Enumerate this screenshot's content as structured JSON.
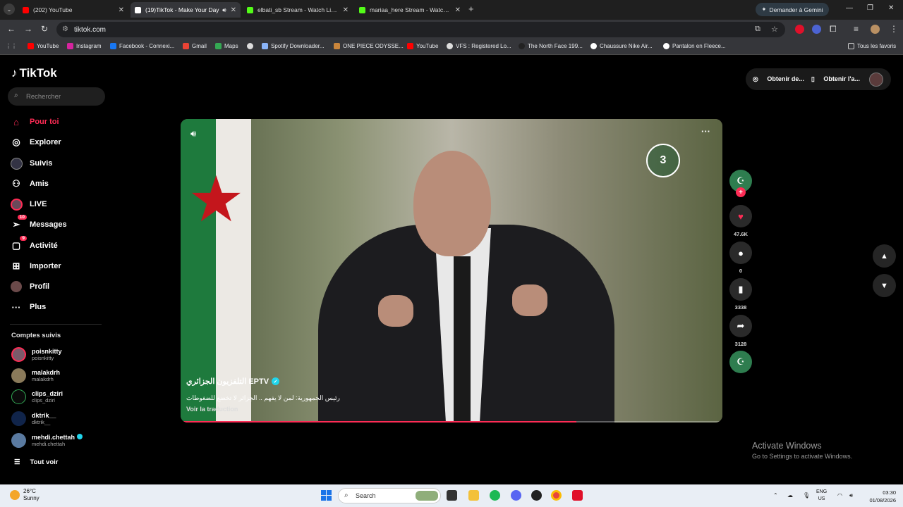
{
  "browser": {
    "tabs": [
      {
        "title": "(202) YouTube",
        "color": "#ff0000",
        "active": false
      },
      {
        "title": "(19)TikTok - Make Your Day",
        "color": "#ffffff",
        "active": true
      },
      {
        "title": "elbati_sb Stream - Watch Live o",
        "color": "#53fc18",
        "active": false
      },
      {
        "title": "mariaa_here Stream - Watch Liv",
        "color": "#53fc18",
        "active": false
      }
    ],
    "gemini_button": "Demander à Gemini",
    "url": "tiktok.com",
    "bookmarks": [
      "YouTube",
      "Instagram",
      "Facebook - Connexi...",
      "Gmail",
      "Maps",
      "",
      "Spotify Downloader...",
      "ONE PIECE ODYSSE...",
      "YouTube",
      "VFS : Registered Lo...",
      "The North Face 199...",
      "Chaussure Nike Air...",
      "Pantalon en Fleece..."
    ],
    "all_bookmarks": "Tous les favoris"
  },
  "tiktok": {
    "logo": "TikTok",
    "search_placeholder": "Rechercher",
    "nav": [
      {
        "label": "Pour toi",
        "icon": "home-icon",
        "active": true
      },
      {
        "label": "Explorer",
        "icon": "compass-icon"
      },
      {
        "label": "Suivis",
        "icon": "following-icon"
      },
      {
        "label": "Amis",
        "icon": "friends-icon"
      },
      {
        "label": "LIVE",
        "icon": "live-icon"
      },
      {
        "label": "Messages",
        "icon": "messages-icon",
        "badge": "10"
      },
      {
        "label": "Activité",
        "icon": "activity-icon",
        "badge": "9"
      },
      {
        "label": "Importer",
        "icon": "upload-icon"
      },
      {
        "label": "Profil",
        "icon": "profile-icon"
      },
      {
        "label": "Plus",
        "icon": "more-icon"
      }
    ],
    "following_title": "Comptes suivis",
    "accounts": [
      {
        "name": "poisnkitty",
        "handle": "poisnkitty"
      },
      {
        "name": "malakdrh",
        "handle": "malakdrh"
      },
      {
        "name": "clips_dziri",
        "handle": "clips_dziri"
      },
      {
        "name": "dktrik__",
        "handle": "dktrik__"
      },
      {
        "name": "mehdi.chettah",
        "handle": "mehdi.chettah"
      }
    ],
    "see_all": "Tout voir",
    "get_coins": "Obtenir de...",
    "get_app": "Obtenir l'a...",
    "video": {
      "channel_logo_text": "3",
      "author": "التلفزيون الجزائري EPTV",
      "caption": "رئيس الجمهورية: لمن لا يفهم .. الجزائر لا تخضع للضغوطات",
      "translate": "Voir la traduction",
      "progress": 0.73
    },
    "actions": {
      "likes": "47.6K",
      "comments": "0",
      "saves": "3338",
      "shares": "3128"
    }
  },
  "windows": {
    "activate_title": "Activate Windows",
    "activate_sub": "Go to Settings to activate Windows.",
    "weather_temp": "26°C",
    "weather_cond": "Sunny",
    "weather_badge": "3",
    "search": "Search",
    "lang_top": "ENG",
    "lang_bottom": "US",
    "time": "03:30",
    "date": "01/08/2026"
  }
}
